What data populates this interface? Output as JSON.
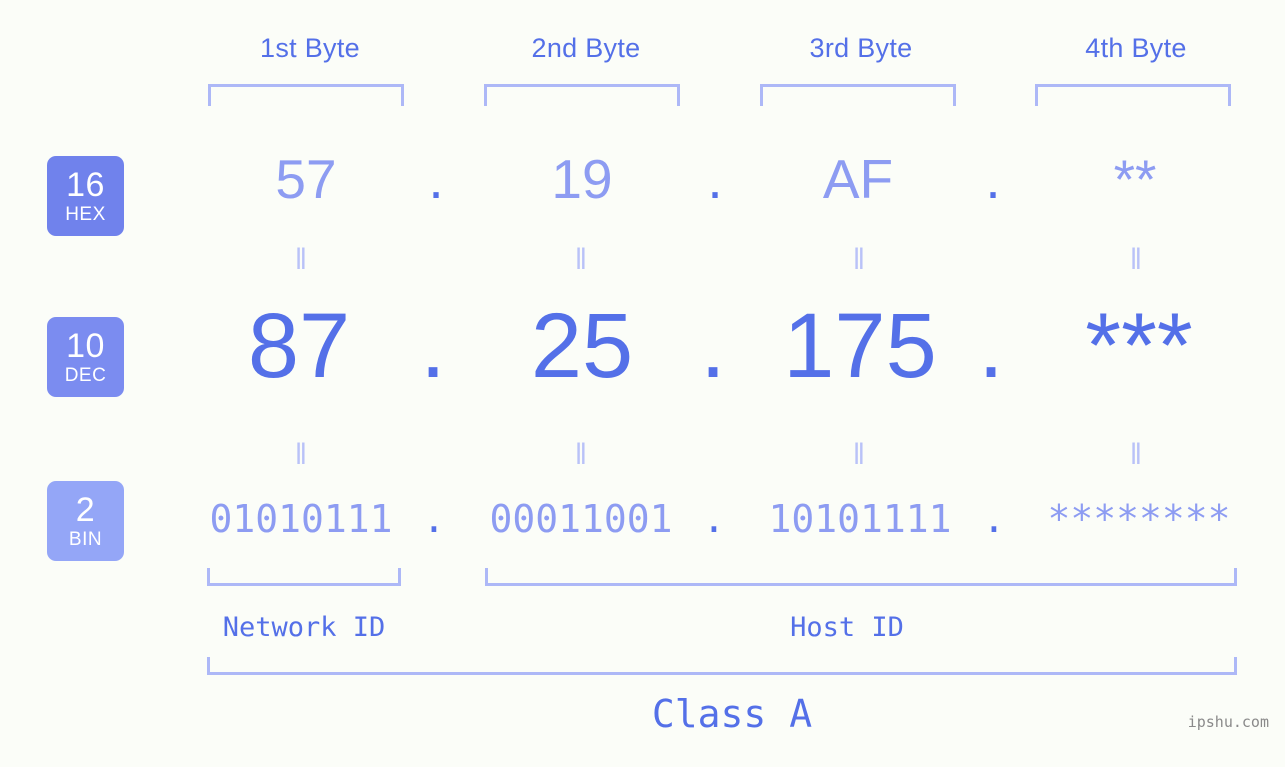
{
  "page": {
    "background": "#fbfdf8",
    "accent": "#5470e8",
    "accent_light": "#8d9cf2",
    "bracket_color": "#adb8f7",
    "badge_color": "#7082ec",
    "badge_color_light": "#94a6f7"
  },
  "byte_headers": [
    {
      "label": "1st Byte"
    },
    {
      "label": "2nd Byte"
    },
    {
      "label": "3rd Byte"
    },
    {
      "label": "4th Byte"
    }
  ],
  "bases": [
    {
      "number": "16",
      "name": "HEX"
    },
    {
      "number": "10",
      "name": "DEC"
    },
    {
      "number": "2",
      "name": "BIN"
    }
  ],
  "rows": {
    "hex": {
      "base_number": "16",
      "base_name": "HEX",
      "values": [
        "57",
        "19",
        "AF",
        "**"
      ],
      "separators": [
        ".",
        ".",
        "."
      ]
    },
    "dec": {
      "base_number": "10",
      "base_name": "DEC",
      "values": [
        "87",
        "25",
        "175",
        "***"
      ],
      "separators": [
        ".",
        ".",
        "."
      ]
    },
    "bin": {
      "base_number": "2",
      "base_name": "BIN",
      "values": [
        "01010111",
        "00011001",
        "10101111",
        "********"
      ],
      "separators": [
        ".",
        ".",
        "."
      ]
    }
  },
  "equality": {
    "glyph": "‖",
    "rows": [
      [
        "‖",
        "‖",
        "‖",
        "‖"
      ],
      [
        "‖",
        "‖",
        "‖",
        "‖"
      ]
    ]
  },
  "segments": {
    "network_id": "Network ID",
    "host_id": "Host ID",
    "class": "Class A"
  },
  "watermark": "ipshu.com"
}
